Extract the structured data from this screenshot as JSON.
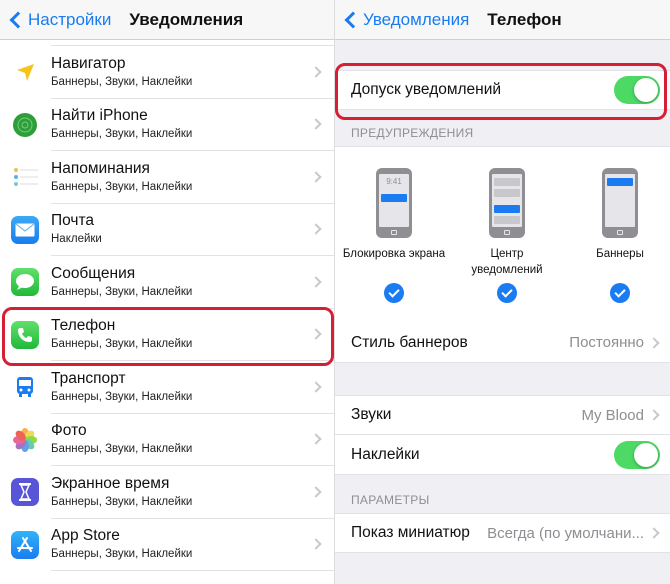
{
  "left": {
    "back_label": "Настройки",
    "title": "Уведомления",
    "apps": [
      {
        "name": "Навигатор",
        "subtitle": "Баннеры, Звуки, Наклейки",
        "icon": "navigator-icon"
      },
      {
        "name": "Найти iPhone",
        "subtitle": "Баннеры, Звуки, Наклейки",
        "icon": "find-iphone-icon"
      },
      {
        "name": "Напоминания",
        "subtitle": "Баннеры, Звуки, Наклейки",
        "icon": "reminders-icon"
      },
      {
        "name": "Почта",
        "subtitle": "Наклейки",
        "icon": "mail-icon"
      },
      {
        "name": "Сообщения",
        "subtitle": "Баннеры, Звуки, Наклейки",
        "icon": "messages-icon"
      },
      {
        "name": "Телефон",
        "subtitle": "Баннеры, Звуки, Наклейки",
        "icon": "phone-icon"
      },
      {
        "name": "Транспорт",
        "subtitle": "Баннеры, Звуки, Наклейки",
        "icon": "transit-icon"
      },
      {
        "name": "Фото",
        "subtitle": "Баннеры, Звуки, Наклейки",
        "icon": "photos-icon"
      },
      {
        "name": "Экранное время",
        "subtitle": "Баннеры, Звуки, Наклейки",
        "icon": "screen-time-icon"
      },
      {
        "name": "App Store",
        "subtitle": "Баннеры, Звуки, Наклейки",
        "icon": "app-store-icon"
      }
    ]
  },
  "right": {
    "back_label": "Уведомления",
    "title": "Телефон",
    "allow_label": "Допуск уведомлений",
    "allow_on": true,
    "alerts_header": "ПРЕДУПРЕЖДЕНИЯ",
    "alerts": [
      {
        "label": "Блокировка экрана",
        "checked": true,
        "time": "9:41"
      },
      {
        "label": "Центр уведомлений",
        "checked": true
      },
      {
        "label": "Баннеры",
        "checked": true
      }
    ],
    "banner_style_label": "Стиль баннеров",
    "banner_style_value": "Постоянно",
    "sounds_label": "Звуки",
    "sounds_value": "My Blood",
    "badges_label": "Наклейки",
    "badges_on": true,
    "options_header": "ПАРАМЕТРЫ",
    "previews_label": "Показ миниатюр",
    "previews_value": "Всегда (по умолчани..."
  },
  "colors": {
    "accent": "#1a7cf0",
    "toggle_on": "#4cd964",
    "highlight": "#d61e35"
  }
}
